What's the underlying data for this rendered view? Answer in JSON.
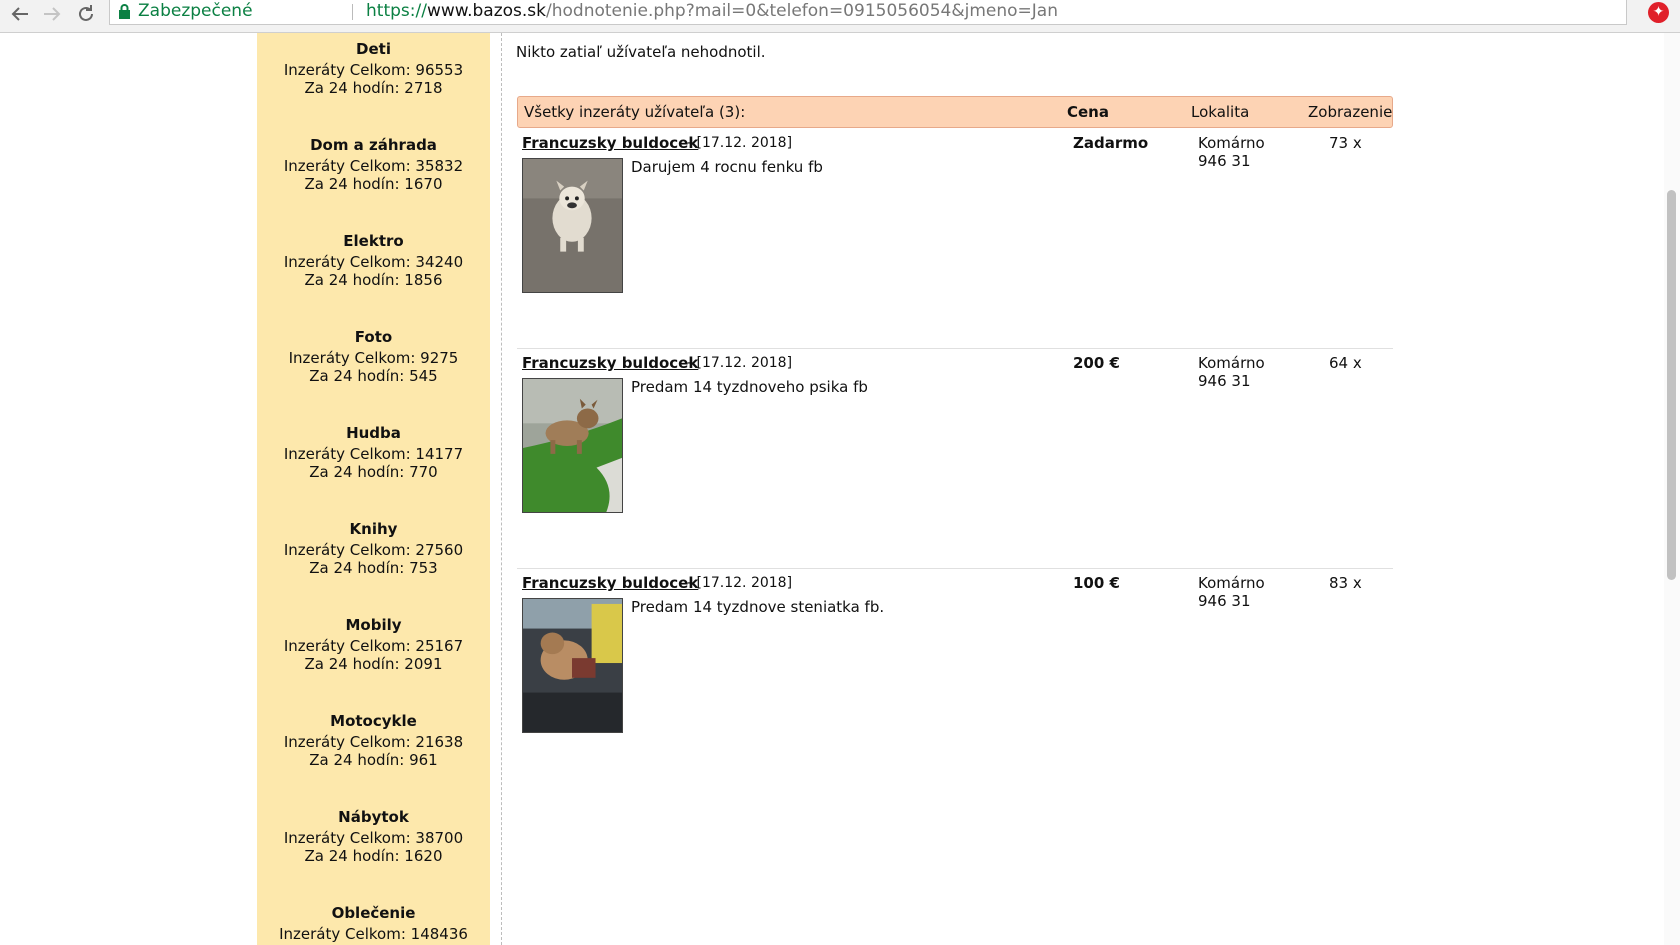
{
  "browser": {
    "secure_label": "Zabezpečené",
    "url_protocol": "https://",
    "url_host": "www.bazos.sk",
    "url_path": "/hodnotenie.php?mail=0&telefon=0915056054&jmeno=Jan",
    "back_icon": "arrow-left-icon",
    "forward_icon": "arrow-right-icon",
    "reload_icon": "reload-icon",
    "bookmark_icon": "star-icon",
    "extension_icon": "extension-icon"
  },
  "sidebar": {
    "categories": [
      {
        "name": "Deti",
        "total": "Inzeráty Celkom: 96553",
        "day": "Za 24 hodín: 2718"
      },
      {
        "name": "Dom a záhrada",
        "total": "Inzeráty Celkom: 35832",
        "day": "Za 24 hodín: 1670"
      },
      {
        "name": "Elektro",
        "total": "Inzeráty Celkom: 34240",
        "day": "Za 24 hodín: 1856"
      },
      {
        "name": "Foto",
        "total": "Inzeráty Celkom: 9275",
        "day": "Za 24 hodín: 545"
      },
      {
        "name": "Hudba",
        "total": "Inzeráty Celkom: 14177",
        "day": "Za 24 hodín: 770"
      },
      {
        "name": "Knihy",
        "total": "Inzeráty Celkom: 27560",
        "day": "Za 24 hodín: 753"
      },
      {
        "name": "Mobily",
        "total": "Inzeráty Celkom: 25167",
        "day": "Za 24 hodín: 2091"
      },
      {
        "name": "Motocykle",
        "total": "Inzeráty Celkom: 21638",
        "day": "Za 24 hodín: 961"
      },
      {
        "name": "Nábytok",
        "total": "Inzeráty Celkom: 38700",
        "day": "Za 24 hodín: 1620"
      },
      {
        "name": "Oblečenie",
        "total": "Inzeráty Celkom: 148436",
        "day": ""
      }
    ]
  },
  "main": {
    "rating_note": "Nikto zatiaľ užívateľa nehodnotil.",
    "table_header": {
      "title": "Všetky inzeráty užívateľa (3):",
      "price": "Cena",
      "location": "Lokalita",
      "views": "Zobrazenie"
    },
    "listings": [
      {
        "title": "Francuzsky buldocek",
        "date": "- [17.12. 2018]",
        "description": "Darujem 4 rocnu fenku fb",
        "price": "Zadarmo",
        "location_city": "Komárno",
        "location_zip": "946 31",
        "views": "73 x"
      },
      {
        "title": "Francuzsky buldocek",
        "date": "- [17.12. 2018]",
        "description": "Predam 14 tyzdnoveho psika fb",
        "price": "200 €",
        "location_city": "Komárno",
        "location_zip": "946 31",
        "views": "64 x"
      },
      {
        "title": "Francuzsky buldocek",
        "date": "- [17.12. 2018]",
        "description": "Predam 14 tyzdnove steniatka fb.",
        "price": "100 €",
        "location_city": "Komárno",
        "location_zip": "946 31",
        "views": "83 x"
      }
    ]
  }
}
